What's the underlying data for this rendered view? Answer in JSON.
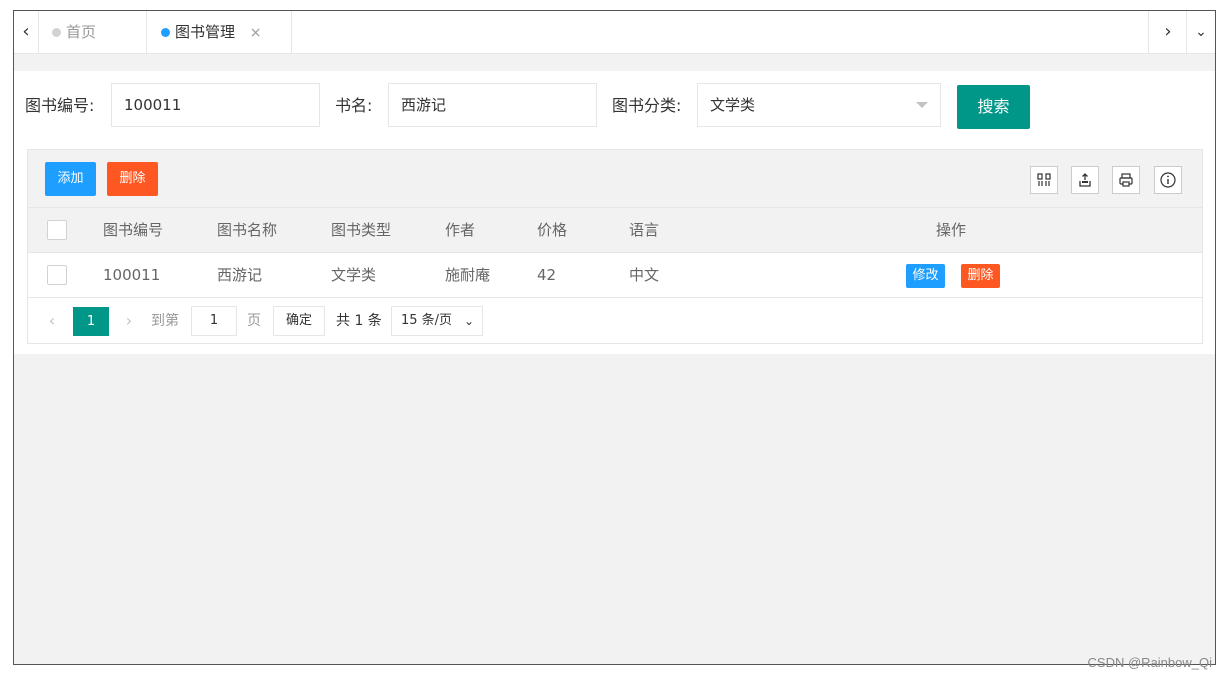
{
  "tabs": {
    "left_arrow": "‹",
    "right_arrow": "›",
    "more": "⌄",
    "items": [
      {
        "label": "首页"
      },
      {
        "label": "图书管理",
        "close": "×"
      }
    ]
  },
  "search": {
    "book_no_label": "图书编号:",
    "book_no_value": "100011",
    "name_label": "书名:",
    "name_value": "西游记",
    "category_label": "图书分类:",
    "category_value": "文学类",
    "button": "搜索"
  },
  "toolbar": {
    "add": "添加",
    "delete": "删除",
    "icons": [
      "columns-icon",
      "export-icon",
      "print-icon",
      "info-icon"
    ]
  },
  "table": {
    "headers": [
      "图书编号",
      "图书名称",
      "图书类型",
      "作者",
      "价格",
      "语言",
      "操作"
    ],
    "rows": [
      {
        "no": "100011",
        "name": "西游记",
        "type": "文学类",
        "author": "施耐庵",
        "price": "42",
        "language": "中文",
        "edit": "修改",
        "delete": "删除"
      }
    ]
  },
  "pagination": {
    "current": "1",
    "goto_label": "到第",
    "goto_value": "1",
    "page_unit": "页",
    "confirm": "确定",
    "total": "共 1 条",
    "page_size": "15 条/页"
  },
  "watermark": "CSDN @Rainbow_Qi",
  "colors": {
    "primary": "#009688",
    "blue": "#1e9fff",
    "danger": "#ff5722"
  }
}
